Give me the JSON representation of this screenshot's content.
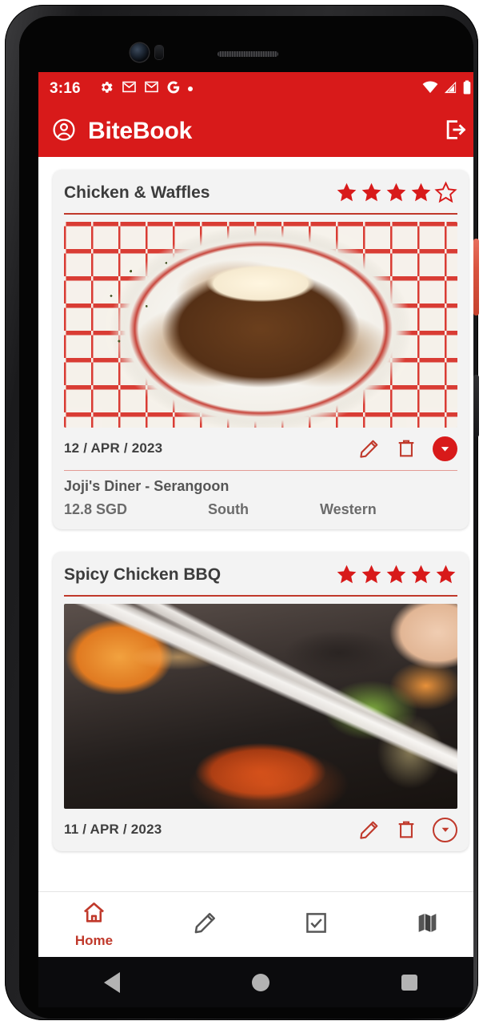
{
  "status_bar": {
    "time": "3:16",
    "left_icons": [
      "gear-icon",
      "gmail-icon",
      "gmail-icon",
      "google-icon",
      "dot-icon"
    ],
    "right_icons": [
      "wifi-icon",
      "cellular-signal-icon",
      "battery-icon"
    ],
    "background_color": "#d81a1a",
    "foreground_color": "#ffffff"
  },
  "app_bar": {
    "title": "BiteBook",
    "profile_icon": "account-circle-icon",
    "logout_icon": "logout-icon",
    "background_color": "#d81a1a"
  },
  "theme": {
    "primary_red": "#d81a1a",
    "accent_red": "#c0392b",
    "card_background": "#f3f3f3",
    "text_dark": "#3c3c3c",
    "text_muted": "#6b6b6b"
  },
  "cards": [
    {
      "title": "Chicken & Waffles",
      "rating": 4,
      "max_rating": 5,
      "date": "12 / APR / 2023",
      "photo_alt": "chicken and waffles with fried egg on checkered-rim plate",
      "expanded": true,
      "expand_icon": "chevron-down-icon",
      "edit_icon": "pencil-icon",
      "delete_icon": "trash-icon",
      "detail": {
        "place": "Joji's Diner - Serangoon",
        "price": "12.8 SGD",
        "area": "South",
        "cuisine": "Western"
      }
    },
    {
      "title": "Spicy Chicken BBQ",
      "rating": 5,
      "max_rating": 5,
      "date": "11 / APR / 2023",
      "photo_alt": "korean bbq spicy chicken held with tongs on grill",
      "expanded": false,
      "expand_icon": "chevron-down-icon",
      "edit_icon": "pencil-icon",
      "delete_icon": "trash-icon",
      "detail": null
    }
  ],
  "bottom_nav": {
    "items": [
      {
        "icon": "home-icon",
        "label": "Home",
        "active": true
      },
      {
        "icon": "pencil-icon",
        "label": "",
        "active": false
      },
      {
        "icon": "checkbox-icon",
        "label": "",
        "active": false
      },
      {
        "icon": "map-icon",
        "label": "",
        "active": false
      }
    ]
  },
  "system_nav": {
    "back": "back-triangle-icon",
    "home": "home-circle-icon",
    "recents": "recents-square-icon"
  }
}
